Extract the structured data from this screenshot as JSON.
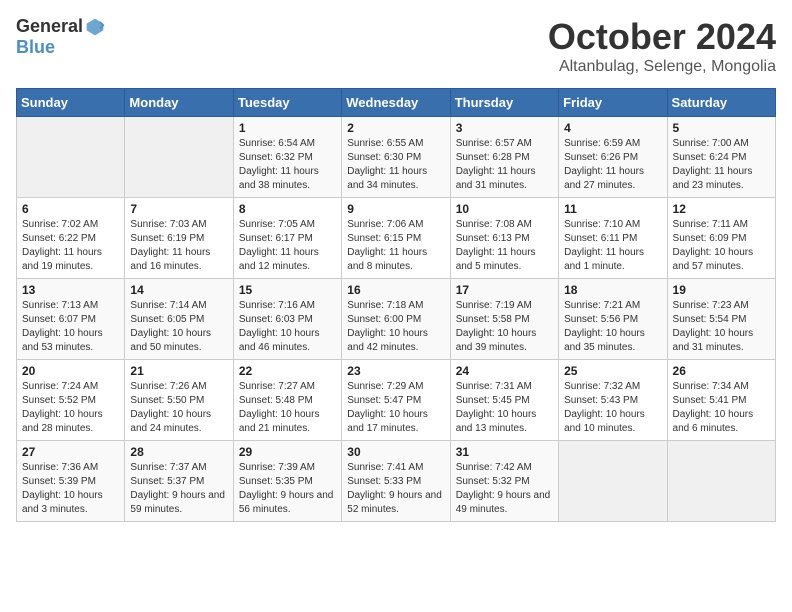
{
  "header": {
    "logo_general": "General",
    "logo_blue": "Blue",
    "month": "October 2024",
    "location": "Altanbulag, Selenge, Mongolia"
  },
  "weekdays": [
    "Sunday",
    "Monday",
    "Tuesday",
    "Wednesday",
    "Thursday",
    "Friday",
    "Saturday"
  ],
  "weeks": [
    [
      {
        "day": "",
        "info": ""
      },
      {
        "day": "",
        "info": ""
      },
      {
        "day": "1",
        "info": "Sunrise: 6:54 AM\nSunset: 6:32 PM\nDaylight: 11 hours and 38 minutes."
      },
      {
        "day": "2",
        "info": "Sunrise: 6:55 AM\nSunset: 6:30 PM\nDaylight: 11 hours and 34 minutes."
      },
      {
        "day": "3",
        "info": "Sunrise: 6:57 AM\nSunset: 6:28 PM\nDaylight: 11 hours and 31 minutes."
      },
      {
        "day": "4",
        "info": "Sunrise: 6:59 AM\nSunset: 6:26 PM\nDaylight: 11 hours and 27 minutes."
      },
      {
        "day": "5",
        "info": "Sunrise: 7:00 AM\nSunset: 6:24 PM\nDaylight: 11 hours and 23 minutes."
      }
    ],
    [
      {
        "day": "6",
        "info": "Sunrise: 7:02 AM\nSunset: 6:22 PM\nDaylight: 11 hours and 19 minutes."
      },
      {
        "day": "7",
        "info": "Sunrise: 7:03 AM\nSunset: 6:19 PM\nDaylight: 11 hours and 16 minutes."
      },
      {
        "day": "8",
        "info": "Sunrise: 7:05 AM\nSunset: 6:17 PM\nDaylight: 11 hours and 12 minutes."
      },
      {
        "day": "9",
        "info": "Sunrise: 7:06 AM\nSunset: 6:15 PM\nDaylight: 11 hours and 8 minutes."
      },
      {
        "day": "10",
        "info": "Sunrise: 7:08 AM\nSunset: 6:13 PM\nDaylight: 11 hours and 5 minutes."
      },
      {
        "day": "11",
        "info": "Sunrise: 7:10 AM\nSunset: 6:11 PM\nDaylight: 11 hours and 1 minute."
      },
      {
        "day": "12",
        "info": "Sunrise: 7:11 AM\nSunset: 6:09 PM\nDaylight: 10 hours and 57 minutes."
      }
    ],
    [
      {
        "day": "13",
        "info": "Sunrise: 7:13 AM\nSunset: 6:07 PM\nDaylight: 10 hours and 53 minutes."
      },
      {
        "day": "14",
        "info": "Sunrise: 7:14 AM\nSunset: 6:05 PM\nDaylight: 10 hours and 50 minutes."
      },
      {
        "day": "15",
        "info": "Sunrise: 7:16 AM\nSunset: 6:03 PM\nDaylight: 10 hours and 46 minutes."
      },
      {
        "day": "16",
        "info": "Sunrise: 7:18 AM\nSunset: 6:00 PM\nDaylight: 10 hours and 42 minutes."
      },
      {
        "day": "17",
        "info": "Sunrise: 7:19 AM\nSunset: 5:58 PM\nDaylight: 10 hours and 39 minutes."
      },
      {
        "day": "18",
        "info": "Sunrise: 7:21 AM\nSunset: 5:56 PM\nDaylight: 10 hours and 35 minutes."
      },
      {
        "day": "19",
        "info": "Sunrise: 7:23 AM\nSunset: 5:54 PM\nDaylight: 10 hours and 31 minutes."
      }
    ],
    [
      {
        "day": "20",
        "info": "Sunrise: 7:24 AM\nSunset: 5:52 PM\nDaylight: 10 hours and 28 minutes."
      },
      {
        "day": "21",
        "info": "Sunrise: 7:26 AM\nSunset: 5:50 PM\nDaylight: 10 hours and 24 minutes."
      },
      {
        "day": "22",
        "info": "Sunrise: 7:27 AM\nSunset: 5:48 PM\nDaylight: 10 hours and 21 minutes."
      },
      {
        "day": "23",
        "info": "Sunrise: 7:29 AM\nSunset: 5:47 PM\nDaylight: 10 hours and 17 minutes."
      },
      {
        "day": "24",
        "info": "Sunrise: 7:31 AM\nSunset: 5:45 PM\nDaylight: 10 hours and 13 minutes."
      },
      {
        "day": "25",
        "info": "Sunrise: 7:32 AM\nSunset: 5:43 PM\nDaylight: 10 hours and 10 minutes."
      },
      {
        "day": "26",
        "info": "Sunrise: 7:34 AM\nSunset: 5:41 PM\nDaylight: 10 hours and 6 minutes."
      }
    ],
    [
      {
        "day": "27",
        "info": "Sunrise: 7:36 AM\nSunset: 5:39 PM\nDaylight: 10 hours and 3 minutes."
      },
      {
        "day": "28",
        "info": "Sunrise: 7:37 AM\nSunset: 5:37 PM\nDaylight: 9 hours and 59 minutes."
      },
      {
        "day": "29",
        "info": "Sunrise: 7:39 AM\nSunset: 5:35 PM\nDaylight: 9 hours and 56 minutes."
      },
      {
        "day": "30",
        "info": "Sunrise: 7:41 AM\nSunset: 5:33 PM\nDaylight: 9 hours and 52 minutes."
      },
      {
        "day": "31",
        "info": "Sunrise: 7:42 AM\nSunset: 5:32 PM\nDaylight: 9 hours and 49 minutes."
      },
      {
        "day": "",
        "info": ""
      },
      {
        "day": "",
        "info": ""
      }
    ]
  ]
}
